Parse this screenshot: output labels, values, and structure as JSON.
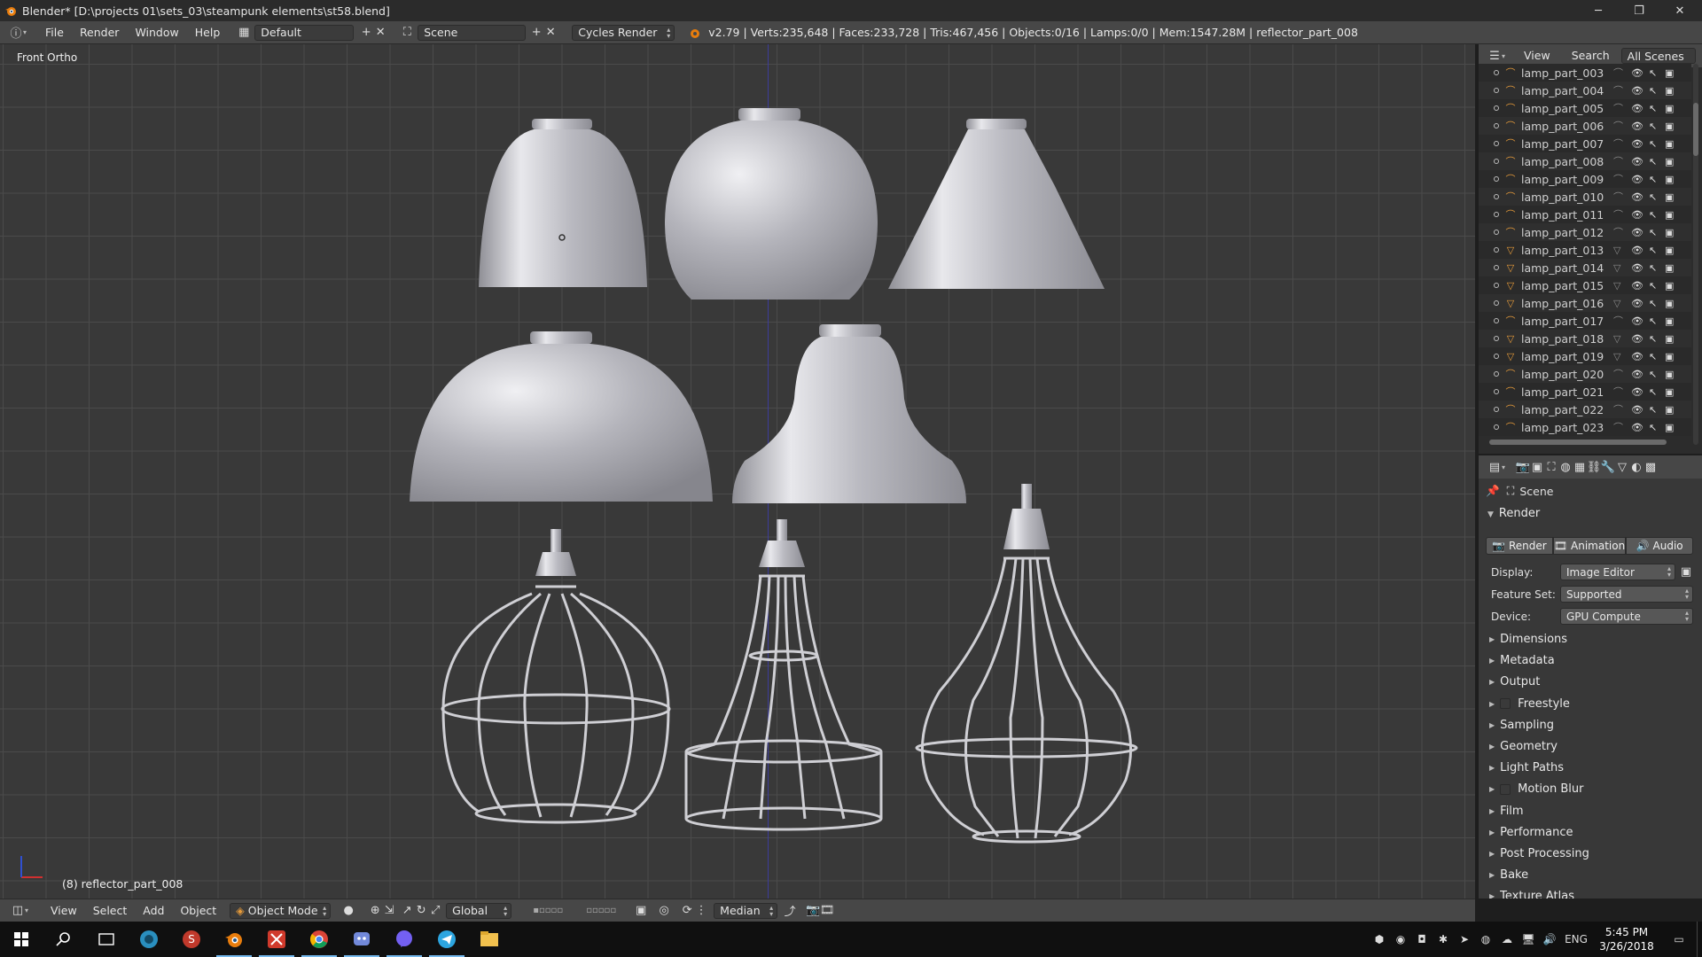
{
  "window": {
    "title": "Blender* [D:\\projects 01\\sets_03\\steampunk elements\\st58.blend]",
    "controls": [
      "─",
      "❐",
      "✕"
    ]
  },
  "info_header": {
    "menus": [
      "File",
      "Render",
      "Window",
      "Help"
    ],
    "screen_layout": "Default",
    "scene": "Scene",
    "render_engine": "Cycles Render",
    "stats": "v2.79 | Verts:235,648 | Faces:233,728 | Tris:467,456 | Objects:0/16 | Lamps:0/0 | Mem:1547.28M | reflector_part_008"
  },
  "viewport": {
    "view_label": "Front Ortho",
    "object_label": "(8) reflector_part_008"
  },
  "viewport_header": {
    "menus": [
      "View",
      "Select",
      "Add",
      "Object"
    ],
    "mode": "Object Mode",
    "orientation": "Global",
    "pivot": "Median"
  },
  "outliner": {
    "header": {
      "view": "View",
      "search": "Search",
      "filter": "All Scenes"
    },
    "items": [
      {
        "name": "lamp_part_003",
        "type": "curve"
      },
      {
        "name": "lamp_part_004",
        "type": "curve"
      },
      {
        "name": "lamp_part_005",
        "type": "curve"
      },
      {
        "name": "lamp_part_006",
        "type": "curve"
      },
      {
        "name": "lamp_part_007",
        "type": "curve"
      },
      {
        "name": "lamp_part_008",
        "type": "curve"
      },
      {
        "name": "lamp_part_009",
        "type": "curve"
      },
      {
        "name": "lamp_part_010",
        "type": "curve"
      },
      {
        "name": "lamp_part_011",
        "type": "curve"
      },
      {
        "name": "lamp_part_012",
        "type": "curve"
      },
      {
        "name": "lamp_part_013",
        "type": "mesh"
      },
      {
        "name": "lamp_part_014",
        "type": "mesh"
      },
      {
        "name": "lamp_part_015",
        "type": "mesh"
      },
      {
        "name": "lamp_part_016",
        "type": "mesh"
      },
      {
        "name": "lamp_part_017",
        "type": "curve"
      },
      {
        "name": "lamp_part_018",
        "type": "mesh"
      },
      {
        "name": "lamp_part_019",
        "type": "mesh"
      },
      {
        "name": "lamp_part_020",
        "type": "curve"
      },
      {
        "name": "lamp_part_021",
        "type": "curve"
      },
      {
        "name": "lamp_part_022",
        "type": "curve"
      },
      {
        "name": "lamp_part_023",
        "type": "curve"
      }
    ]
  },
  "properties": {
    "context": "Scene",
    "panel": "Render",
    "tabs": [
      "Render",
      "Animation",
      "Audio"
    ],
    "fields": [
      {
        "label": "Display:",
        "value": "Image Editor"
      },
      {
        "label": "Feature Set:",
        "value": "Supported"
      },
      {
        "label": "Device:",
        "value": "GPU Compute"
      }
    ],
    "subpanels": [
      {
        "label": "Dimensions",
        "checkbox": false
      },
      {
        "label": "Metadata",
        "checkbox": false
      },
      {
        "label": "Output",
        "checkbox": false
      },
      {
        "label": "Freestyle",
        "checkbox": true
      },
      {
        "label": "Sampling",
        "checkbox": false
      },
      {
        "label": "Geometry",
        "checkbox": false
      },
      {
        "label": "Light Paths",
        "checkbox": false
      },
      {
        "label": "Motion Blur",
        "checkbox": true
      },
      {
        "label": "Film",
        "checkbox": false
      },
      {
        "label": "Performance",
        "checkbox": false
      },
      {
        "label": "Post Processing",
        "checkbox": false
      },
      {
        "label": "Bake",
        "checkbox": false
      },
      {
        "label": "Texture Atlas",
        "checkbox": false
      }
    ]
  },
  "taskbar": {
    "apps": [
      "start-icon",
      "search-icon",
      "task-view-icon",
      "browser-icon",
      "app-s-icon",
      "blender-icon",
      "xmind-icon",
      "chrome-icon",
      "discord-icon",
      "viber-icon",
      "telegram-icon",
      "explorer-icon"
    ],
    "language": "ENG",
    "time": "5:45 PM",
    "date": "3/26/2018"
  },
  "colors": {
    "accent_orange": "#e59a3a",
    "selection_blue": "#5680c2",
    "grid": "#4b4b4b",
    "viewport_bg": "#393939"
  }
}
